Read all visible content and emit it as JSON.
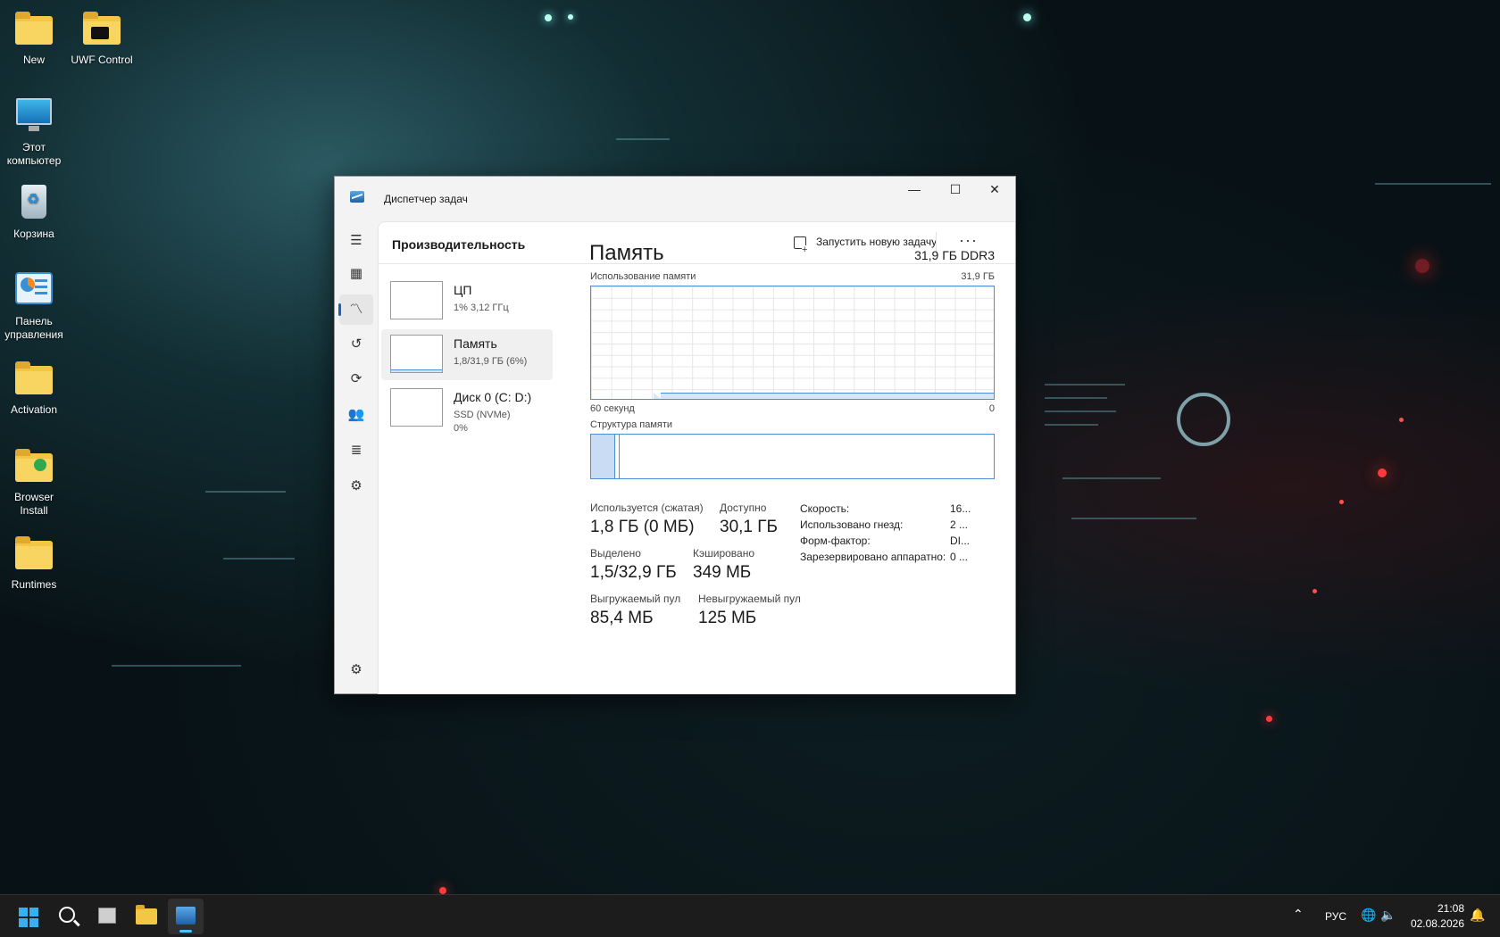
{
  "desktop": {
    "icons": [
      {
        "label": "New",
        "icon": "folder-icon"
      },
      {
        "label": "UWF Control",
        "icon": "folder-icon"
      },
      {
        "label": "Этот компьютер",
        "icon": "computer-icon"
      },
      {
        "label": "Корзина",
        "icon": "recycle-bin-icon"
      },
      {
        "label": "Панель управления",
        "icon": "control-panel-icon"
      },
      {
        "label": "Activation",
        "icon": "folder-icon"
      },
      {
        "label": "Browser Install",
        "icon": "folder-icon"
      },
      {
        "label": "Runtimes",
        "icon": "folder-icon"
      }
    ]
  },
  "window": {
    "title": "Диспетчер задач",
    "controls": {
      "minimize": "—",
      "maximize": "☐",
      "close": "✕"
    }
  },
  "header": {
    "title": "Производительность",
    "run_task": "Запустить новую задачу",
    "more": "···"
  },
  "resources": [
    {
      "name": "ЦП",
      "sub1": "1% 3,12 ГГц",
      "sub2": ""
    },
    {
      "name": "Память",
      "sub1": "1,8/31,9 ГБ (6%)",
      "sub2": ""
    },
    {
      "name": "Диск 0 (C: D:)",
      "sub1": "SSD (NVMe)",
      "sub2": "0%"
    }
  ],
  "memory": {
    "title": "Память",
    "spec": "31,9 ГБ DDR3",
    "usage_label": "Использование памяти",
    "usage_max": "31,9 ГБ",
    "time_left": "60 секунд",
    "time_right": "0",
    "structure_label": "Структура памяти",
    "usage_fraction": 0.06,
    "stats": {
      "in_use_label": "Используется (сжатая)",
      "in_use_value": "1,8 ГБ (0 МБ)",
      "available_label": "Доступно",
      "available_value": "30,1 ГБ",
      "committed_label": "Выделено",
      "committed_value": "1,5/32,9 ГБ",
      "cached_label": "Кэшировано",
      "cached_value": "349 МБ",
      "paged_label": "Выгружаемый пул",
      "paged_value": "85,4 МБ",
      "nonpaged_label": "Невыгружаемый пул",
      "nonpaged_value": "125 МБ"
    },
    "props": [
      {
        "label": "Скорость:",
        "value": "16..."
      },
      {
        "label": "Использовано гнезд:",
        "value": "2 ..."
      },
      {
        "label": "Форм-фактор:",
        "value": "DI..."
      },
      {
        "label": "Зарезервировано аппаратно:",
        "value": "0 ..."
      }
    ]
  },
  "taskbar": {
    "language": "РУС",
    "time": "21:08",
    "date": "02.08.2026"
  },
  "colors": {
    "accent": "#1a62b8",
    "graph_line": "#4c8fd6",
    "graph_fill": "#d7e6f7"
  }
}
